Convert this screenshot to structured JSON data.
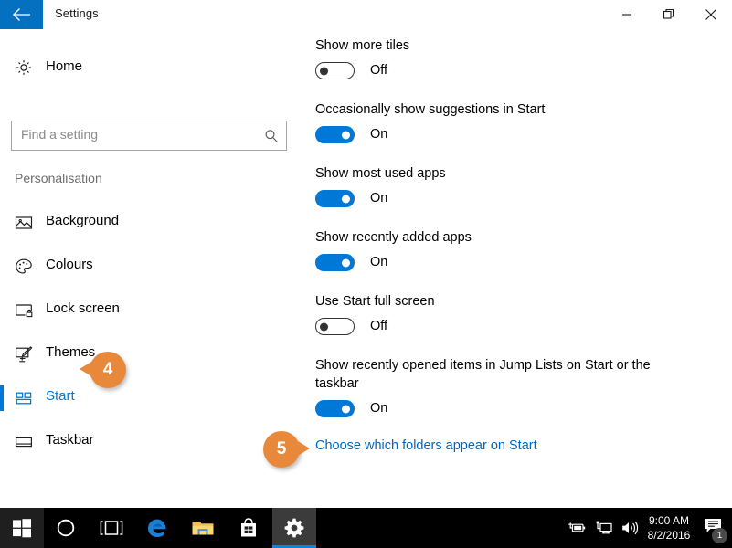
{
  "window": {
    "title": "Settings",
    "back_icon": "back-arrow-icon",
    "controls": {
      "minimize": "minimize-icon",
      "maximize": "restore-icon",
      "close": "close-icon"
    }
  },
  "sidebar": {
    "home": {
      "label": "Home",
      "icon": "gear-icon"
    },
    "search": {
      "placeholder": "Find a setting",
      "value": "",
      "icon": "search-icon"
    },
    "section_header": "Personalisation",
    "items": [
      {
        "label": "Background",
        "icon": "picture-icon",
        "selected": false
      },
      {
        "label": "Colours",
        "icon": "palette-icon",
        "selected": false
      },
      {
        "label": "Lock screen",
        "icon": "lock-screen-icon",
        "selected": false
      },
      {
        "label": "Themes",
        "icon": "brush-icon",
        "selected": false
      },
      {
        "label": "Start",
        "icon": "start-tiles-icon",
        "selected": true
      },
      {
        "label": "Taskbar",
        "icon": "taskbar-icon",
        "selected": false
      }
    ]
  },
  "content": {
    "settings": [
      {
        "label": "Show more tiles",
        "state": "Off",
        "on": false
      },
      {
        "label": "Occasionally show suggestions in Start",
        "state": "On",
        "on": true
      },
      {
        "label": "Show most used apps",
        "state": "On",
        "on": true
      },
      {
        "label": "Show recently added apps",
        "state": "On",
        "on": true
      },
      {
        "label": "Use Start full screen",
        "state": "Off",
        "on": false
      },
      {
        "label": "Show recently opened items in Jump Lists on Start or the taskbar",
        "state": "On",
        "on": true
      }
    ],
    "folders_link": "Choose which folders appear on Start"
  },
  "callouts": [
    {
      "number": "4",
      "direction": "left"
    },
    {
      "number": "5",
      "direction": "right"
    }
  ],
  "taskbar": {
    "buttons": [
      {
        "name": "start-button",
        "icon": "windows-logo-icon"
      },
      {
        "name": "cortana-button",
        "icon": "cortana-circle-icon"
      },
      {
        "name": "task-view-button",
        "icon": "task-view-icon"
      },
      {
        "name": "edge-button",
        "icon": "edge-icon"
      },
      {
        "name": "file-explorer-button",
        "icon": "folder-icon"
      },
      {
        "name": "store-button",
        "icon": "store-bag-icon"
      },
      {
        "name": "settings-button",
        "icon": "gear-icon"
      }
    ],
    "tray": {
      "power_icon": "battery-plug-icon",
      "network_icon": "network-monitor-icon",
      "volume_icon": "speaker-icon",
      "time": "9:00 AM",
      "date": "8/2/2016",
      "action_center_icon": "speech-bubble-icon",
      "notification_count": "1"
    }
  },
  "colors": {
    "accent": "#0078d7",
    "titlebar_back": "#0470c0",
    "callout": "#e8883a",
    "link": "#0067c0"
  }
}
